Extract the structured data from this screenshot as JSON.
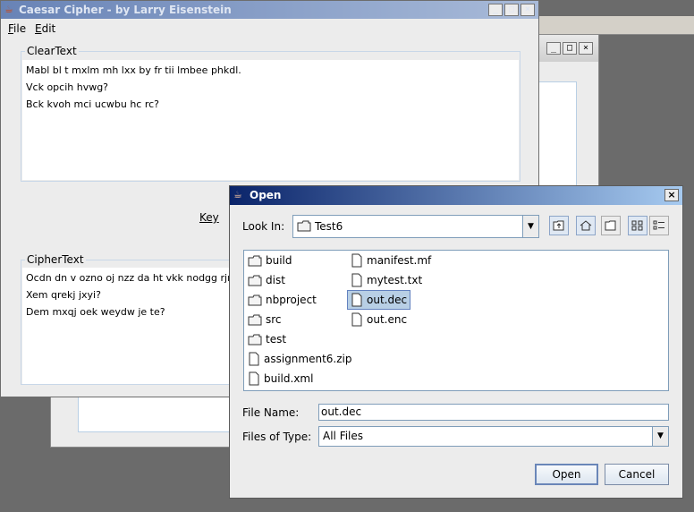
{
  "main_window": {
    "title": "Caesar Cipher - by Larry Eisenstein",
    "menus": [
      {
        "label": "File",
        "mnemonic": "F",
        "rest": "ile"
      },
      {
        "label": "Edit",
        "mnemonic": "E",
        "rest": "dit"
      }
    ],
    "clear_text": {
      "label": "ClearText",
      "lines": [
        "Mabl bl t mxlm mh lxx by fr tii lmbee phkdl.",
        "Vck opcih hvwg?",
        "Bck kvoh mci ucwbu hc rc?"
      ]
    },
    "key_label": "Key",
    "cipher_text": {
      "label": "CipherText",
      "lines": [
        "Ocdn dn v ozno oj nzz da ht vkk nodgg rjmf",
        "Xem qrekj jxyi?",
        "Dem mxqj oek weydw je te?"
      ]
    }
  },
  "dialog": {
    "title": "Open",
    "look_in_label": "Look In:",
    "look_in_value": "Test6",
    "files": [
      {
        "name": "build",
        "type": "folder",
        "selected": false
      },
      {
        "name": "dist",
        "type": "folder",
        "selected": false
      },
      {
        "name": "nbproject",
        "type": "folder",
        "selected": false
      },
      {
        "name": "src",
        "type": "folder",
        "selected": false
      },
      {
        "name": "test",
        "type": "folder",
        "selected": false
      },
      {
        "name": "assignment6.zip",
        "type": "file",
        "selected": false
      },
      {
        "name": "build.xml",
        "type": "file",
        "selected": false
      },
      {
        "name": "manifest.mf",
        "type": "file",
        "selected": false
      },
      {
        "name": "mytest.txt",
        "type": "file",
        "selected": false
      },
      {
        "name": "out.dec",
        "type": "file",
        "selected": true
      },
      {
        "name": "out.enc",
        "type": "file",
        "selected": false
      }
    ],
    "file_name_label": "File Name:",
    "file_name_value": "out.dec",
    "files_of_type_label": "Files of Type:",
    "files_of_type_value": "All Files",
    "open_button": "Open",
    "cancel_button": "Cancel"
  }
}
